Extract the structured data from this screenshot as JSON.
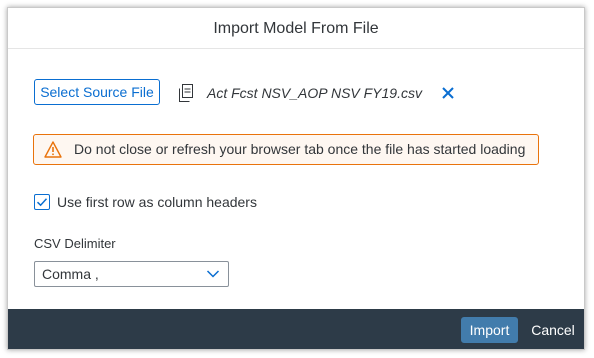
{
  "dialog": {
    "title": "Import Model From File"
  },
  "source": {
    "button_label": "Select Source File",
    "file_icon": "document-icon",
    "file_name": "Act Fcst NSV_AOP NSV FY19.csv",
    "remove_icon": "close-icon"
  },
  "warning": {
    "icon": "warning-icon",
    "text": "Do not close or refresh your browser tab once the file has started loading"
  },
  "options": {
    "first_row_headers_label": "Use first row as column headers",
    "first_row_headers_checked": true
  },
  "delimiter": {
    "label": "CSV Delimiter",
    "selected": "Comma ,"
  },
  "footer": {
    "import_label": "Import",
    "cancel_label": "Cancel"
  },
  "colors": {
    "accent": "#0a6ed1",
    "warning_border": "#e9730c",
    "warning_bg": "#fef7f1",
    "footer_bg": "#2d3b48",
    "primary_button": "#427cac",
    "text": "#32363a"
  }
}
